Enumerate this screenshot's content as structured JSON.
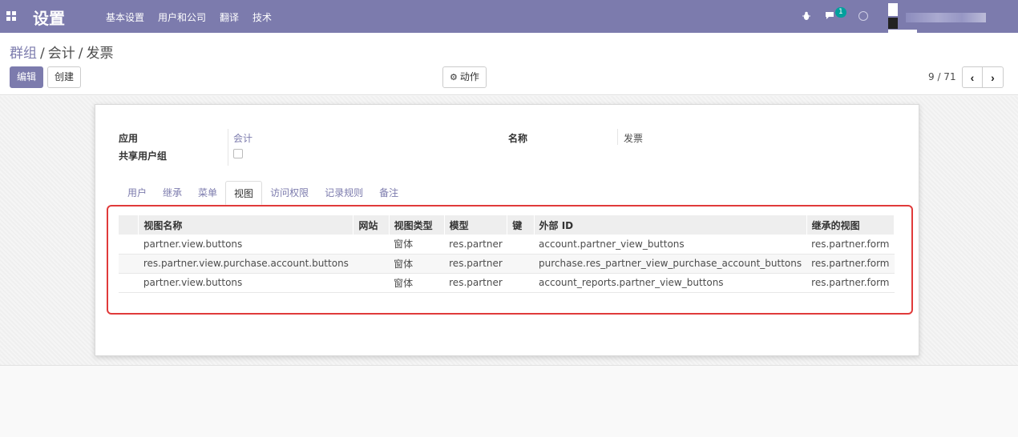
{
  "navbar": {
    "app_title": "设置",
    "menu": [
      "基本设置",
      "用户和公司",
      "翻译",
      "技术"
    ],
    "chat_count": "1",
    "bg_color": "#7c7bad"
  },
  "breadcrumb": {
    "items": [
      "群组",
      "会计",
      "发票"
    ],
    "separator": "/"
  },
  "buttons": {
    "edit": "编辑",
    "create": "创建",
    "action": "动作"
  },
  "pager": {
    "value": "9 / 71",
    "prev": "‹",
    "next": "›"
  },
  "form": {
    "application_label": "应用",
    "application_value": "会计",
    "name_label": "名称",
    "name_value": "发票",
    "shared_label": "共享用户组"
  },
  "tabs": [
    "用户",
    "继承",
    "菜单",
    "视图",
    "访问权限",
    "记录规则",
    "备注"
  ],
  "active_tab": "视图",
  "views_table": {
    "columns": [
      "视图名称",
      "网站",
      "视图类型",
      "模型",
      "键",
      "外部 ID",
      "继承的视图"
    ],
    "rows": [
      [
        "partner.view.buttons",
        "",
        "窗体",
        "res.partner",
        "",
        "account.partner_view_buttons",
        "res.partner.form"
      ],
      [
        "res.partner.view.purchase.account.buttons",
        "",
        "窗体",
        "res.partner",
        "",
        "purchase.res_partner_view_purchase_account_buttons",
        "res.partner.form"
      ],
      [
        "partner.view.buttons",
        "",
        "窗体",
        "res.partner",
        "",
        "account_reports.partner_view_buttons",
        "res.partner.form"
      ]
    ]
  },
  "colors": {
    "accent": "#7c7bad",
    "highlight": "#e03a3a"
  }
}
